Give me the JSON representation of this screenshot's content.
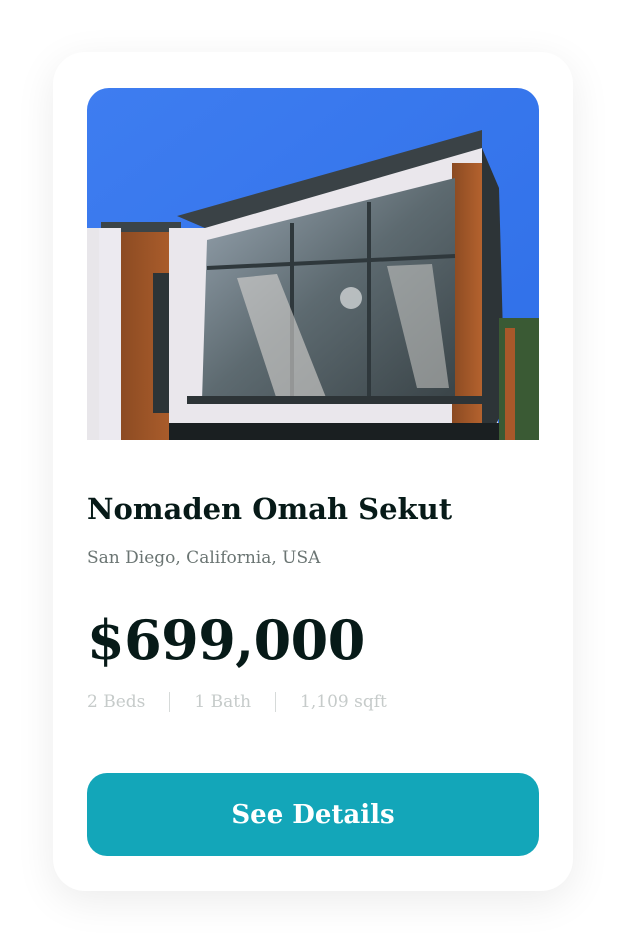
{
  "listing": {
    "image_alt": "modern-house-photo",
    "name": "Nomaden Omah Sekut",
    "location": "San Diego, California, USA",
    "price": "$699,000",
    "specs": [
      "2 Beds",
      "1 Bath",
      "1,109 sqft"
    ],
    "cta_label": "See Details"
  },
  "colors": {
    "accent": "#13a6b9",
    "text": "#071a18",
    "muted": "#6b7573"
  }
}
